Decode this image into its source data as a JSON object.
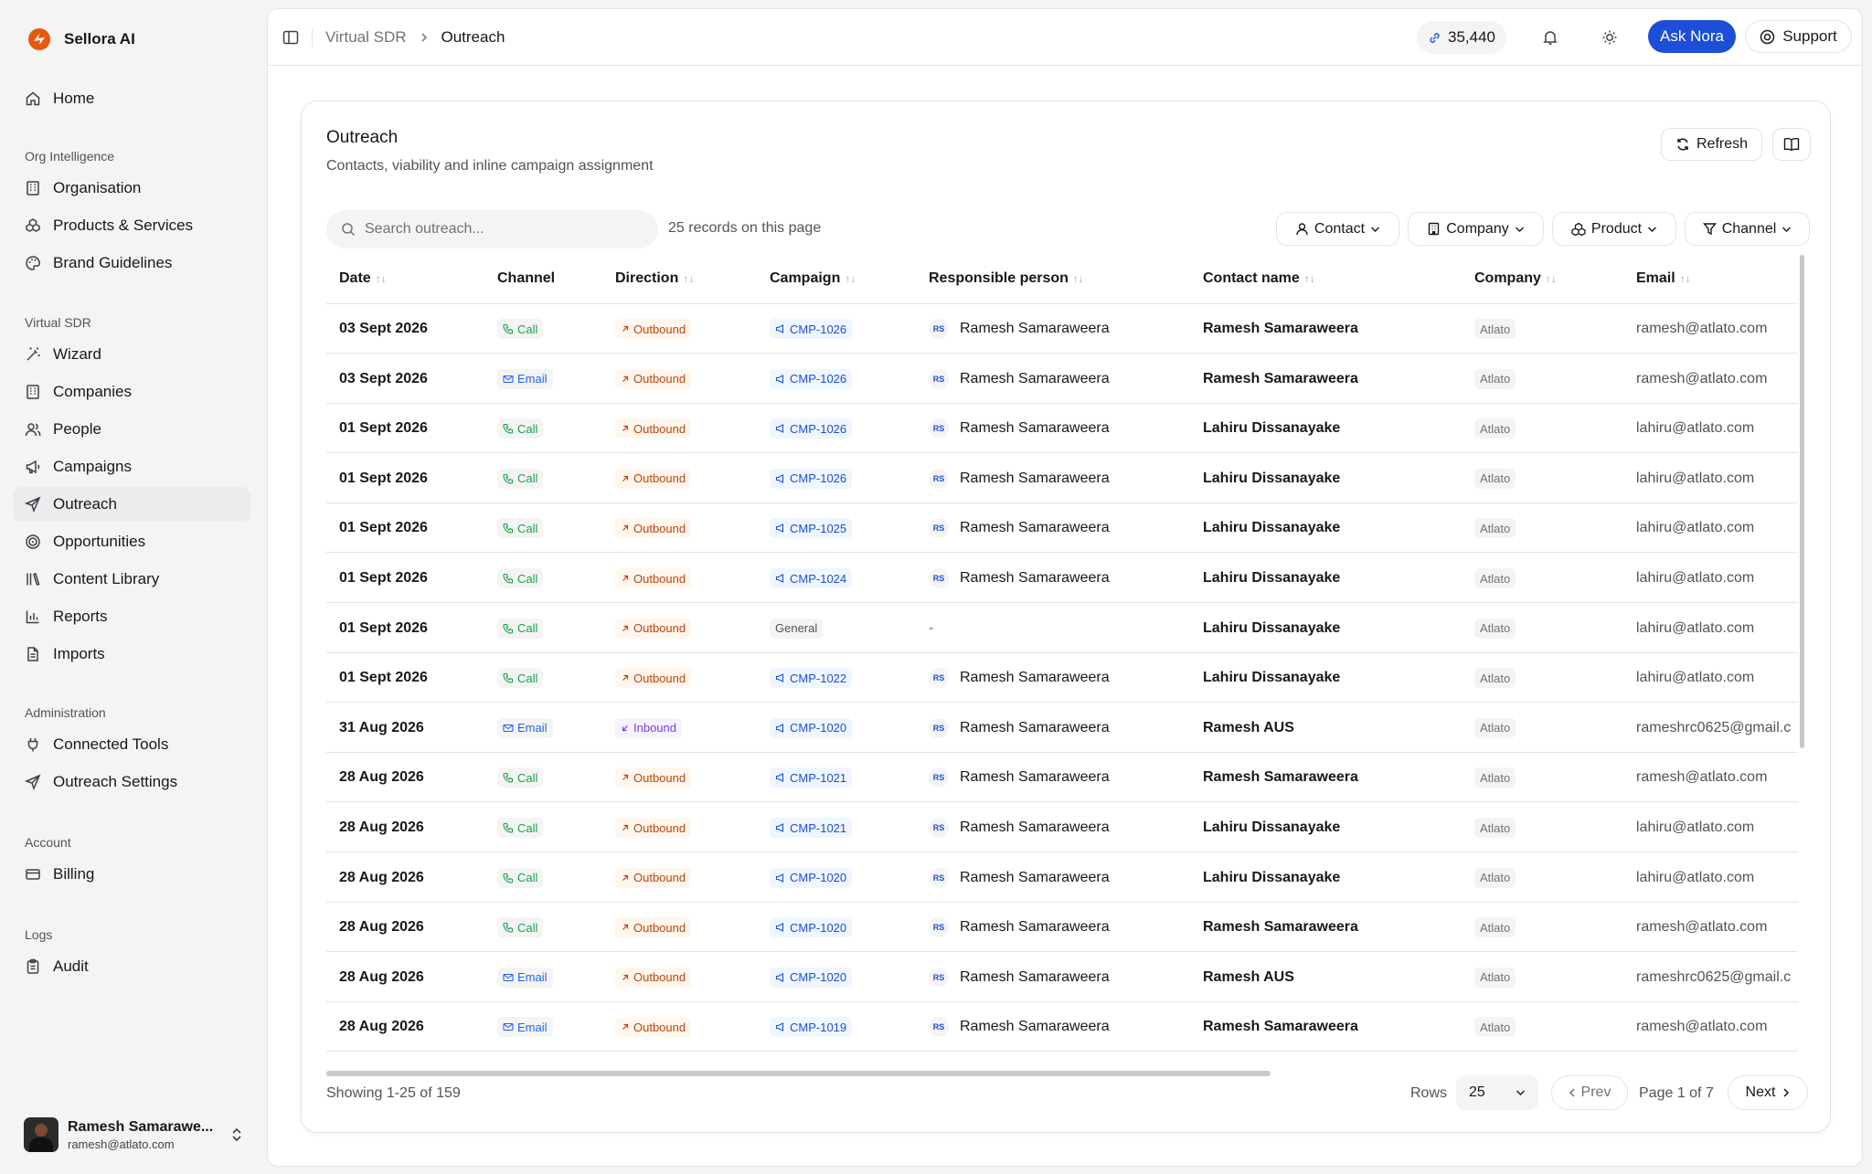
{
  "app": {
    "name": "Sellora AI"
  },
  "sidebar": {
    "top_items": [
      {
        "label": "Home",
        "icon": "home-icon"
      }
    ],
    "groups": [
      {
        "title": "Org Intelligence",
        "items": [
          {
            "label": "Organisation",
            "icon": "building-icon"
          },
          {
            "label": "Products & Services",
            "icon": "boxes-icon"
          },
          {
            "label": "Brand Guidelines",
            "icon": "palette-icon"
          }
        ]
      },
      {
        "title": "Virtual SDR",
        "items": [
          {
            "label": "Wizard",
            "icon": "wand-icon"
          },
          {
            "label": "Companies",
            "icon": "building-icon"
          },
          {
            "label": "People",
            "icon": "users-icon"
          },
          {
            "label": "Campaigns",
            "icon": "megaphone-icon"
          },
          {
            "label": "Outreach",
            "icon": "send-icon",
            "active": true
          },
          {
            "label": "Opportunities",
            "icon": "target-icon"
          },
          {
            "label": "Content Library",
            "icon": "library-icon"
          },
          {
            "label": "Reports",
            "icon": "bar-chart-icon"
          },
          {
            "label": "Imports",
            "icon": "file-icon"
          }
        ]
      },
      {
        "title": "Administration",
        "items": [
          {
            "label": "Connected Tools",
            "icon": "plug-icon"
          },
          {
            "label": "Outreach Settings",
            "icon": "send-icon"
          }
        ]
      },
      {
        "title": "Account",
        "items": [
          {
            "label": "Billing",
            "icon": "credit-card-icon"
          }
        ]
      },
      {
        "title": "Logs",
        "items": [
          {
            "label": "Audit",
            "icon": "clipboard-icon"
          }
        ]
      }
    ],
    "user": {
      "name": "Ramesh Samarawe...",
      "email": "ramesh@atlato.com"
    }
  },
  "topbar": {
    "breadcrumb": [
      "Virtual SDR",
      "Outreach"
    ],
    "credits": "35,440",
    "ask_label": "Ask Nora",
    "support_label": "Support"
  },
  "card": {
    "title": "Outreach",
    "subtitle": "Contacts, viability and inline campaign assignment",
    "refresh_label": "Refresh",
    "search_placeholder": "Search outreach...",
    "records_text": "25 records on this page",
    "filters": [
      "Contact",
      "Company",
      "Product",
      "Channel"
    ]
  },
  "table": {
    "columns": [
      "Date",
      "Channel",
      "Direction",
      "Campaign",
      "Responsible person",
      "Contact name",
      "Company",
      "Email"
    ],
    "rows": [
      {
        "date": "03 Sept 2026",
        "channel": "Call",
        "direction": "Outbound",
        "campaign": "CMP-1026",
        "initials": "RS",
        "person": "Ramesh Samaraweera",
        "contact": "Ramesh Samaraweera",
        "company": "Atlato",
        "email": "ramesh@atlato.com"
      },
      {
        "date": "03 Sept 2026",
        "channel": "Email",
        "direction": "Outbound",
        "campaign": "CMP-1026",
        "initials": "RS",
        "person": "Ramesh Samaraweera",
        "contact": "Ramesh Samaraweera",
        "company": "Atlato",
        "email": "ramesh@atlato.com"
      },
      {
        "date": "01 Sept 2026",
        "channel": "Call",
        "direction": "Outbound",
        "campaign": "CMP-1026",
        "initials": "RS",
        "person": "Ramesh Samaraweera",
        "contact": "Lahiru Dissanayake",
        "company": "Atlato",
        "email": "lahiru@atlato.com"
      },
      {
        "date": "01 Sept 2026",
        "channel": "Call",
        "direction": "Outbound",
        "campaign": "CMP-1026",
        "initials": "RS",
        "person": "Ramesh Samaraweera",
        "contact": "Lahiru Dissanayake",
        "company": "Atlato",
        "email": "lahiru@atlato.com"
      },
      {
        "date": "01 Sept 2026",
        "channel": "Call",
        "direction": "Outbound",
        "campaign": "CMP-1025",
        "initials": "RS",
        "person": "Ramesh Samaraweera",
        "contact": "Lahiru Dissanayake",
        "company": "Atlato",
        "email": "lahiru@atlato.com"
      },
      {
        "date": "01 Sept 2026",
        "channel": "Call",
        "direction": "Outbound",
        "campaign": "CMP-1024",
        "initials": "RS",
        "person": "Ramesh Samaraweera",
        "contact": "Lahiru Dissanayake",
        "company": "Atlato",
        "email": "lahiru@atlato.com"
      },
      {
        "date": "01 Sept 2026",
        "channel": "Call",
        "direction": "Outbound",
        "campaign": "General",
        "initials": "",
        "person": "-",
        "contact": "Lahiru Dissanayake",
        "company": "Atlato",
        "email": "lahiru@atlato.com"
      },
      {
        "date": "01 Sept 2026",
        "channel": "Call",
        "direction": "Outbound",
        "campaign": "CMP-1022",
        "initials": "RS",
        "person": "Ramesh Samaraweera",
        "contact": "Lahiru Dissanayake",
        "company": "Atlato",
        "email": "lahiru@atlato.com"
      },
      {
        "date": "31 Aug 2026",
        "channel": "Email",
        "direction": "Inbound",
        "campaign": "CMP-1020",
        "initials": "RS",
        "person": "Ramesh Samaraweera",
        "contact": "Ramesh AUS",
        "company": "Atlato",
        "email": "rameshrc0625@gmail.c"
      },
      {
        "date": "28 Aug 2026",
        "channel": "Call",
        "direction": "Outbound",
        "campaign": "CMP-1021",
        "initials": "RS",
        "person": "Ramesh Samaraweera",
        "contact": "Ramesh Samaraweera",
        "company": "Atlato",
        "email": "ramesh@atlato.com"
      },
      {
        "date": "28 Aug 2026",
        "channel": "Call",
        "direction": "Outbound",
        "campaign": "CMP-1021",
        "initials": "RS",
        "person": "Ramesh Samaraweera",
        "contact": "Lahiru Dissanayake",
        "company": "Atlato",
        "email": "lahiru@atlato.com"
      },
      {
        "date": "28 Aug 2026",
        "channel": "Call",
        "direction": "Outbound",
        "campaign": "CMP-1020",
        "initials": "RS",
        "person": "Ramesh Samaraweera",
        "contact": "Lahiru Dissanayake",
        "company": "Atlato",
        "email": "lahiru@atlato.com"
      },
      {
        "date": "28 Aug 2026",
        "channel": "Call",
        "direction": "Outbound",
        "campaign": "CMP-1020",
        "initials": "RS",
        "person": "Ramesh Samaraweera",
        "contact": "Ramesh Samaraweera",
        "company": "Atlato",
        "email": "ramesh@atlato.com"
      },
      {
        "date": "28 Aug 2026",
        "channel": "Email",
        "direction": "Outbound",
        "campaign": "CMP-1020",
        "initials": "RS",
        "person": "Ramesh Samaraweera",
        "contact": "Ramesh AUS",
        "company": "Atlato",
        "email": "rameshrc0625@gmail.c"
      },
      {
        "date": "28 Aug 2026",
        "channel": "Email",
        "direction": "Outbound",
        "campaign": "CMP-1019",
        "initials": "RS",
        "person": "Ramesh Samaraweera",
        "contact": "Ramesh Samaraweera",
        "company": "Atlato",
        "email": "ramesh@atlato.com"
      }
    ]
  },
  "footer": {
    "showing": "Showing 1-25 of 159",
    "rows_label": "Rows",
    "rows_value": "25",
    "prev_label": "Prev",
    "page_info": "Page 1 of 7",
    "next_label": "Next"
  },
  "colors": {
    "accent": "#1d4ed8",
    "brand": "#ea580c",
    "call": "#16a34a",
    "outbound": "#c2410c",
    "inbound": "#7c3aed"
  }
}
